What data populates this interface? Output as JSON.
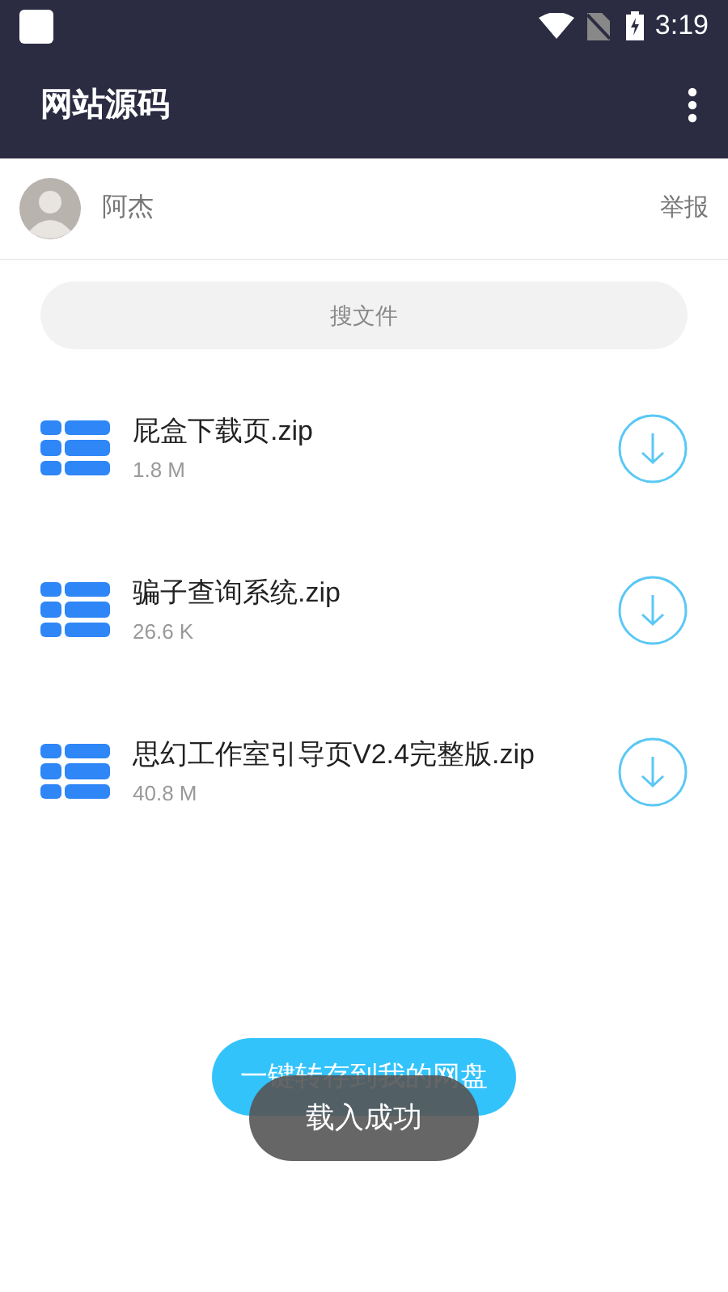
{
  "status_bar": {
    "time": "3:19"
  },
  "toolbar": {
    "title": "网站源码"
  },
  "owner": {
    "name": "阿杰",
    "report": "举报"
  },
  "search": {
    "placeholder": "搜文件"
  },
  "files": [
    {
      "name": "屁盒下载页.zip",
      "size": "1.8 M"
    },
    {
      "name": "骗子查询系统.zip",
      "size": "26.6 K"
    },
    {
      "name": "思幻工作室引导页V2.4完整版.zip",
      "size": "40.8 M"
    }
  ],
  "save_button": "一键转存到我的网盘",
  "toast": "载入成功"
}
